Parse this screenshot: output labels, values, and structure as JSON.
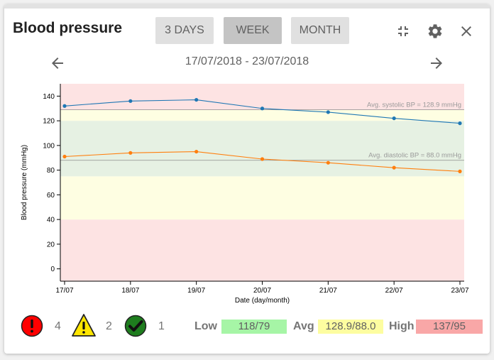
{
  "header": {
    "title": "Blood pressure",
    "ranges": [
      "3 DAYS",
      "WEEK",
      "MONTH"
    ],
    "active_range": "WEEK",
    "icons": [
      "fullscreen-exit-icon",
      "gear-icon",
      "close-icon"
    ]
  },
  "nav": {
    "date_range": "17/07/2018 - 23/07/2018",
    "prev_icon": "arrow-left-icon",
    "next_icon": "arrow-right-icon"
  },
  "chart_data": {
    "type": "line",
    "categories": [
      "17/07",
      "18/07",
      "19/07",
      "20/07",
      "21/07",
      "22/07",
      "23/07"
    ],
    "series": [
      {
        "name": "systolic",
        "values": [
          132,
          136,
          137,
          130,
          127,
          122,
          118
        ],
        "color": "#1f77b4"
      },
      {
        "name": "diastolic",
        "values": [
          91,
          94,
          95,
          89,
          86,
          82,
          79
        ],
        "color": "#ff7f0e"
      }
    ],
    "xlabel": "Date (day/month)",
    "ylabel": "Blood pressure (mmHg)",
    "ylim": [
      -10,
      150
    ],
    "yticks": [
      0,
      20,
      40,
      60,
      80,
      100,
      120,
      140
    ],
    "bands": [
      {
        "from": -10,
        "to": 40,
        "color": "#fde3e3"
      },
      {
        "from": 40,
        "to": 75,
        "color": "#fefee2"
      },
      {
        "from": 75,
        "to": 120,
        "color": "#e6f1e3"
      },
      {
        "from": 120,
        "to": 129,
        "color": "#fefee2"
      },
      {
        "from": 129,
        "to": 150,
        "color": "#fde3e3"
      }
    ],
    "reference_lines": [
      {
        "value": 128.9,
        "label": "Avg. systolic BP = 128.9 mmHg"
      },
      {
        "value": 88.0,
        "label": "Avg. diastolic BP = 88.0 mmHg"
      }
    ]
  },
  "summary": {
    "alerts": {
      "icon": "alert-red-icon",
      "count": "4",
      "color": "#ff0000"
    },
    "warnings": {
      "icon": "warning-yellow-icon",
      "count": "2",
      "color": "#ffe600"
    },
    "ok": {
      "icon": "check-green-icon",
      "count": "1",
      "color": "#1e7d1e"
    },
    "low_label": "Low",
    "low_value": "118/79",
    "low_color": "#a6f5a6",
    "avg_label": "Avg",
    "avg_value": "128.9/88.0",
    "avg_color": "#fdfda0",
    "high_label": "High",
    "high_value": "137/95",
    "high_color": "#f9a7a7"
  }
}
